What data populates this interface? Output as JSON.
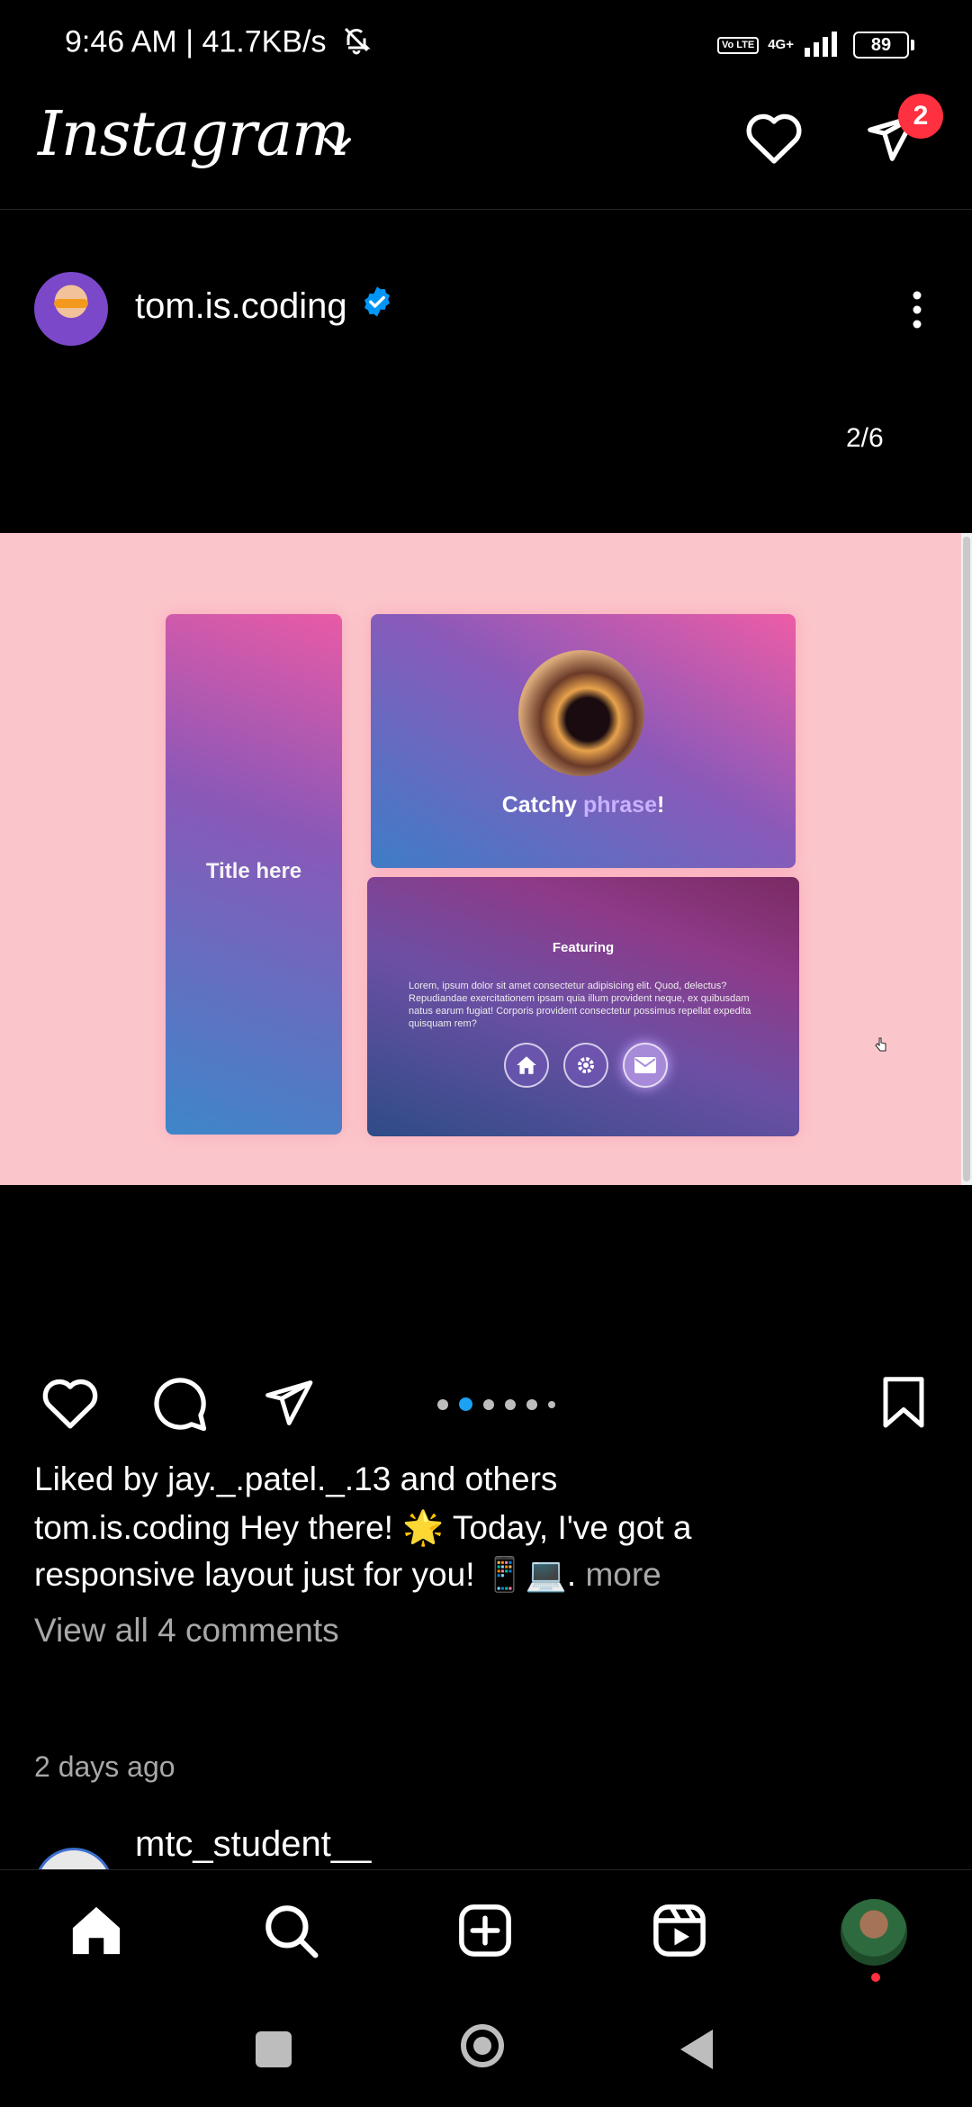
{
  "status_bar": {
    "time_speed": "9:46 AM | 41.7KB/s",
    "volte": "Vo LTE",
    "network": "4G+",
    "battery": "89"
  },
  "header": {
    "logo": "Instagram",
    "dm_badge": "2"
  },
  "post": {
    "username": "tom.is.coding",
    "slide_counter": "2/6",
    "image": {
      "title_card_text": "Title here",
      "catchy_prefix": "Catchy ",
      "catchy_highlight": "phrase",
      "catchy_suffix": "!",
      "featuring": "Featuring",
      "lorem": "Lorem, ipsum dolor sit amet consectetur adipisicing elit. Quod, delectus? Repudiandae exercitationem ipsam quia illum provident neque, ex quibusdam natus earum fugiat! Corporis provident consectetur possimus repellat expedita quisquam rem?",
      "accent_color": "#c9b2ff"
    },
    "carousel": {
      "count": 6,
      "active_index": 1
    },
    "liked_by": "Liked by jay._.patel._.13 and others",
    "caption_line1": "tom.is.coding Hey there! 🌟 Today, I've got a",
    "caption_line2": "responsive layout just for you! 📱💻.",
    "caption_more": " more",
    "view_comments": "View all 4 comments",
    "time_ago": "2 days ago"
  },
  "next_post": {
    "username": "mtc_student__"
  },
  "colors": {
    "badge": "#ff3040",
    "verified": "#0095f6",
    "carousel_active": "#1da1f2"
  }
}
